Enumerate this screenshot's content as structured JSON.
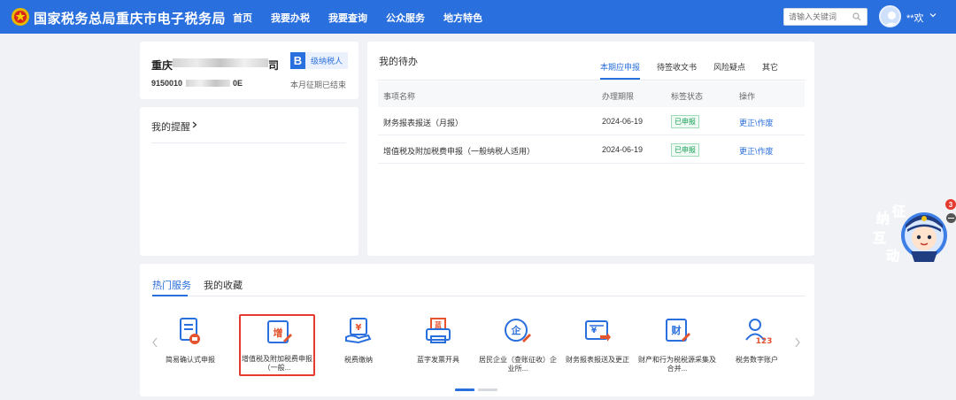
{
  "header": {
    "brand": "国家税务总局重庆市电子税务局",
    "nav": [
      "首页",
      "我要办税",
      "我要查询",
      "公众服务",
      "地方特色"
    ],
    "search_placeholder": "请输入关键词",
    "username": "**欢"
  },
  "company": {
    "name_head": "重庆",
    "name_tail": "司",
    "id_head": "9150010",
    "id_tail": "0E",
    "taxpayer_badge_letter": "B",
    "taxpayer_type": "级纳税人",
    "period_status": "本月征期已结束"
  },
  "reminder": {
    "title": "我的提醒"
  },
  "todo": {
    "title": "我的待办",
    "tabs": [
      "本期应申报",
      "待签收文书",
      "风险疑点",
      "其它"
    ],
    "headers": [
      "事项名称",
      "办理期限",
      "标签状态",
      "操作"
    ],
    "rows": [
      {
        "name": "财务报表报送（月报）",
        "deadline": "2024-06-19",
        "status": "已申报",
        "op": "更正\\作废"
      },
      {
        "name": "增值税及附加税费申报（一般纳税人适用）",
        "deadline": "2024-06-19",
        "status": "已申报",
        "op": "更正\\作废"
      }
    ]
  },
  "hot": {
    "tabs": [
      "热门服务",
      "我的收藏"
    ],
    "services": [
      {
        "label": "简易确认式申报",
        "icon": "doc-stamp-icon"
      },
      {
        "label": "增值税及附加税费申报（一般...",
        "icon": "vat-declare-icon"
      },
      {
        "label": "税费缴纳",
        "icon": "tax-pay-icon"
      },
      {
        "label": "蓝字发票开具",
        "icon": "invoice-print-icon"
      },
      {
        "label": "居民企业（查账征收）企业所...",
        "icon": "enterprise-tax-icon"
      },
      {
        "label": "财务报表报送及更正",
        "icon": "report-submit-icon"
      },
      {
        "label": "财产和行为税税源采集及合并...",
        "icon": "property-tax-icon"
      },
      {
        "label": "税务数字账户",
        "icon": "digital-account-icon"
      }
    ]
  },
  "mascot": {
    "text": [
      "纳",
      "征",
      "互",
      "动"
    ],
    "badge_count": "3"
  }
}
